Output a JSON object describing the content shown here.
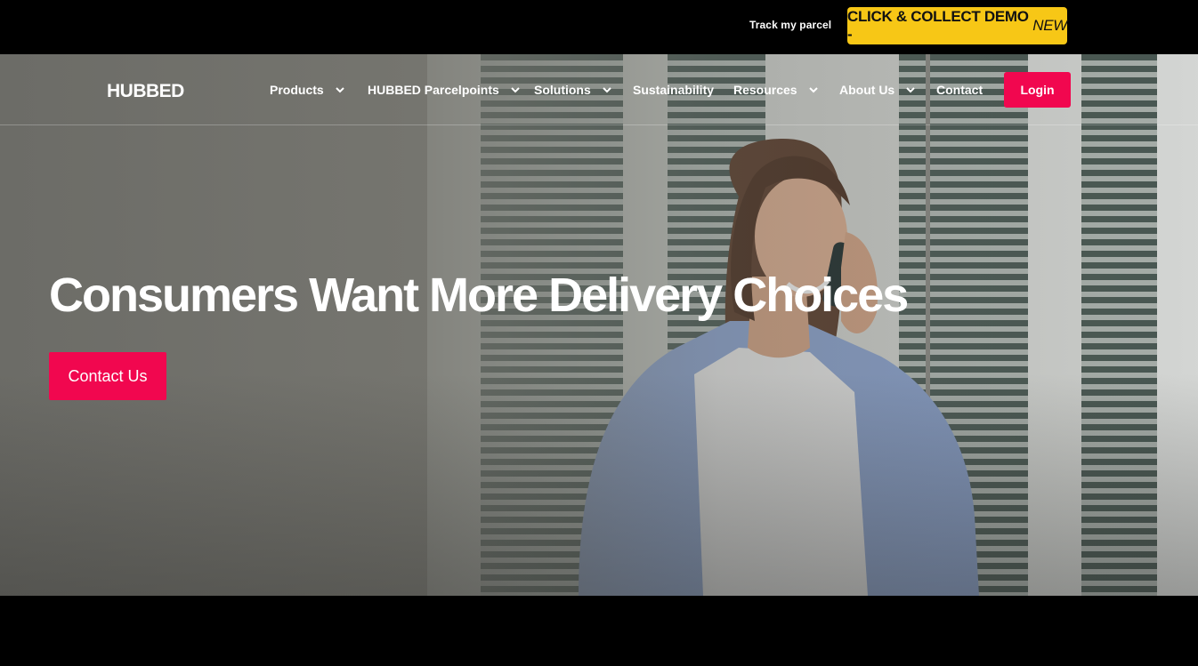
{
  "topbar": {
    "track_label": "Track my parcel",
    "demo_label": "CLICK & COLLECT DEMO -",
    "demo_badge": "NEW",
    "demo_color": "#f7c716"
  },
  "nav": {
    "logo_text": "HUBBED",
    "items": [
      {
        "label": "Products",
        "dropdown": true
      },
      {
        "label": "HUBBED Parcelpoints",
        "dropdown": true
      },
      {
        "label": "Solutions",
        "dropdown": true
      },
      {
        "label": "Sustainability",
        "dropdown": false
      },
      {
        "label": "Resources",
        "dropdown": true
      },
      {
        "label": "About Us",
        "dropdown": true
      },
      {
        "label": "Contact",
        "dropdown": false
      }
    ],
    "login_label": "Login",
    "accent_color": "#f1074f"
  },
  "hero": {
    "headline": "Consumers Want More Delivery Choices",
    "cta_label": "Contact Us",
    "image": "woman-on-phone-photo"
  }
}
